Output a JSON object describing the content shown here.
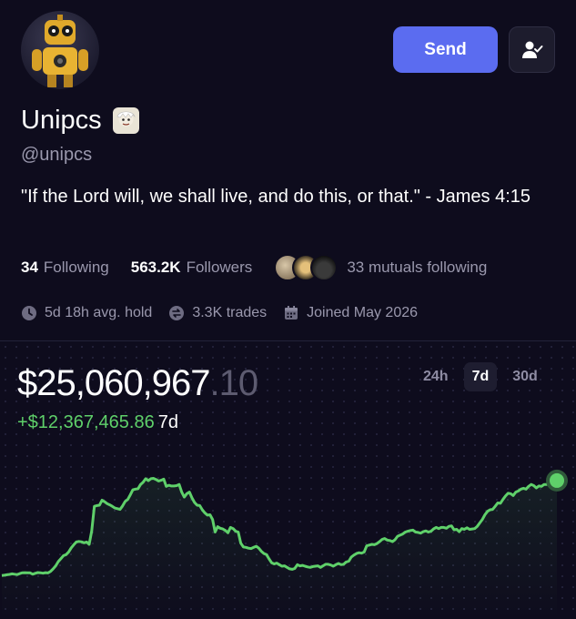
{
  "profile": {
    "display_name": "Unipcs",
    "handle": "@unipcs",
    "bio": "\"If the Lord will, we shall live, and do this, or that.\" - James 4:15"
  },
  "actions": {
    "send_label": "Send",
    "follow_icon": "user-check-icon"
  },
  "stats": {
    "following_count": "34",
    "following_label": "Following",
    "followers_count": "563.2K",
    "followers_label": "Followers",
    "mutuals_label": "33 mutuals following"
  },
  "meta": {
    "avg_hold": "5d 18h avg. hold",
    "trades": "3.3K trades",
    "joined": "Joined May 2026"
  },
  "portfolio": {
    "balance_main": "$25,060,967",
    "balance_cents": ".10",
    "pnl_amount": "+$12,367,465.86",
    "pnl_period": "7d",
    "ranges": [
      "24h",
      "7d",
      "30d"
    ],
    "active_range": "7d"
  },
  "colors": {
    "accent": "#5b6cf0",
    "positive": "#5fd06a",
    "background": "#0e0c1d"
  },
  "chart_data": {
    "type": "line",
    "title": "",
    "xlabel": "",
    "ylabel": "",
    "grid": false,
    "series": [
      {
        "values": [
          12.69,
          12.72,
          12.78,
          12.83,
          12.9,
          12.86,
          12.81,
          12.94,
          13.04,
          13.06,
          13.05,
          13.03,
          12.85,
          12.97,
          13.07,
          13.05,
          12.99,
          13.06,
          13.02,
          13.23,
          13.57,
          13.96,
          14.5,
          14.9,
          15.27,
          15.4,
          15.75,
          16.3,
          16.7,
          17.05,
          17.12,
          17.08,
          16.95,
          17.05,
          16.75,
          18.5,
          21.7,
          21.8,
          21.85,
          22.5,
          22.3,
          22.05,
          21.9,
          21.7,
          21.48,
          21.4,
          21.3,
          21.75,
          22.35,
          22.6,
          23.2,
          23.85,
          23.95,
          24.0,
          24.55,
          24.85,
          25.3,
          25.05,
          25.3,
          25.35,
          25.2,
          25.0,
          25.1,
          25.25,
          24.3,
          24.45,
          24.35,
          24.35,
          24.4,
          24.55,
          23.55,
          22.9,
          23.35,
          23.55,
          22.8,
          22.2,
          21.85,
          21.8,
          21.25,
          20.85,
          20.55,
          20.6,
          20.0,
          18.35,
          19.05,
          18.85,
          18.75,
          18.55,
          18.25,
          18.95,
          18.8,
          18.45,
          18.35,
          16.9,
          16.4,
          16.35,
          16.25,
          16.2,
          16.35,
          16.5,
          16.25,
          15.85,
          15.55,
          15.4,
          14.85,
          14.35,
          14.2,
          14.3,
          14.1,
          13.9,
          13.95,
          13.75,
          13.55,
          13.5,
          13.6,
          14.1,
          13.95,
          14.0,
          13.9,
          13.8,
          13.75,
          13.85,
          13.9,
          13.95,
          13.75,
          13.95,
          14.15,
          14.15,
          14.05,
          13.9,
          14.1,
          14.25,
          14.1,
          14.15,
          14.45,
          14.55,
          15.1,
          15.35,
          15.55,
          15.65,
          15.6,
          15.75,
          16.55,
          16.65,
          16.75,
          16.7,
          16.85,
          17.1,
          17.4,
          17.5,
          17.3,
          17.25,
          17.1,
          17.35,
          17.8,
          17.95,
          18.1,
          18.35,
          18.45,
          18.55,
          18.6,
          18.35,
          18.3,
          18.2,
          18.4,
          18.5,
          18.35,
          18.45,
          18.75,
          18.95,
          18.8,
          18.95,
          18.95,
          18.85,
          19.1,
          19.15,
          18.65,
          18.7,
          18.4,
          18.8,
          18.7,
          18.9,
          18.7,
          18.75,
          18.8,
          19.1,
          19.55,
          20.0,
          20.6,
          21.05,
          21.25,
          21.3,
          21.7,
          22.15,
          22.1,
          22.6,
          23.05,
          23.4,
          23.35,
          23.1,
          23.55,
          23.7,
          23.95,
          24.05,
          23.95,
          24.3,
          24.55,
          24.4,
          24.1,
          24.35,
          24.3,
          24.55,
          24.55,
          24.85,
          25.05,
          25.1,
          25.06
        ]
      }
    ],
    "end_value": 25.06,
    "value_unit": "$M",
    "period": "7d"
  }
}
